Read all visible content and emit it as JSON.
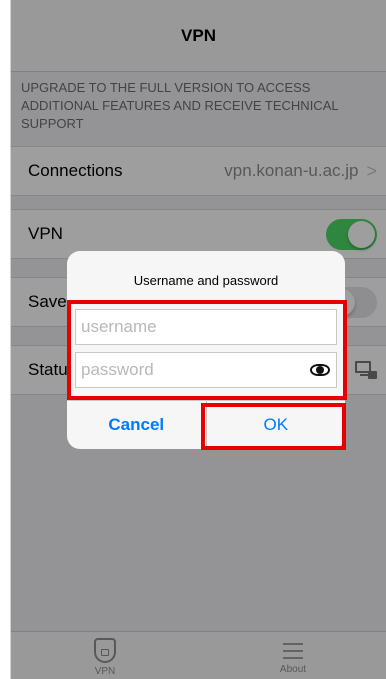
{
  "navbar": {
    "title": "VPN"
  },
  "upgrade_text": "UPGRADE TO THE FULL VERSION TO ACCESS ADDITIONAL FEATURES AND RECEIVE TECHNICAL SUPPORT",
  "connections": {
    "label": "Connections",
    "value": "vpn.konan-u.ac.jp",
    "chevron": ">"
  },
  "vpn_row": {
    "label": "VPN",
    "toggle_on": true
  },
  "save_row": {
    "label": "Save",
    "toggle_on": false
  },
  "status_row": {
    "label": "Statu",
    "icon": "computer-lock-icon"
  },
  "dialog": {
    "title": "Username and password",
    "username_placeholder": "username",
    "password_placeholder": "password",
    "cancel_label": "Cancel",
    "ok_label": "OK"
  },
  "tabbar": {
    "tabs": [
      {
        "label": "VPN",
        "icon": "shield-lock-icon"
      },
      {
        "label": "About",
        "icon": "list-icon"
      }
    ]
  },
  "colors": {
    "accent": "#007aff",
    "toggle_on": "#4cd964",
    "highlight": "#e60000"
  }
}
